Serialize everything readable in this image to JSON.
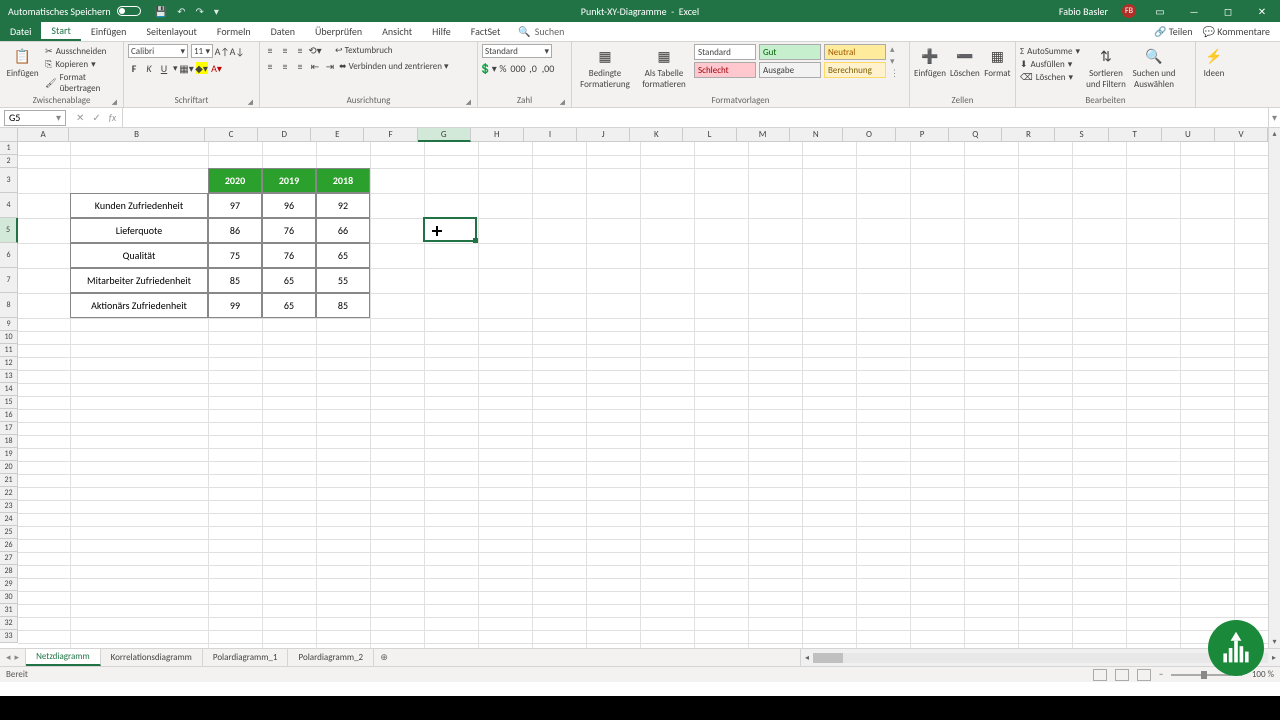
{
  "titlebar": {
    "autosave": "Automatisches Speichern",
    "doc_name": "Punkt-XY-Diagramme",
    "app_name": "Excel",
    "user": "Fabio Basler",
    "initials": "FB"
  },
  "menu": {
    "file": "Datei",
    "tabs": [
      "Start",
      "Einfügen",
      "Seitenlayout",
      "Formeln",
      "Daten",
      "Überprüfen",
      "Ansicht",
      "Hilfe",
      "FactSet"
    ],
    "search": "Suchen",
    "share": "Teilen",
    "comments": "Kommentare"
  },
  "ribbon": {
    "clipboard": {
      "paste": "Einfügen",
      "cut": "Ausschneiden",
      "copy": "Kopieren",
      "format_painter": "Format übertragen",
      "group": "Zwischenablage"
    },
    "font": {
      "name": "Calibri",
      "size": "11",
      "group": "Schriftart"
    },
    "align": {
      "wrap": "Textumbruch",
      "merge": "Verbinden und zentrieren",
      "group": "Ausrichtung"
    },
    "number": {
      "format": "Standard",
      "group": "Zahl"
    },
    "styles": {
      "cond": "Bedingte Formatierung",
      "astable": "Als Tabelle formatieren",
      "standard": "Standard",
      "gut": "Gut",
      "neutral": "Neutral",
      "schlecht": "Schlecht",
      "ausgabe": "Ausgabe",
      "berechnung": "Berechnung",
      "group": "Formatvorlagen"
    },
    "cells": {
      "insert": "Einfügen",
      "delete": "Löschen",
      "format": "Format",
      "group": "Zellen"
    },
    "editing": {
      "autosum": "AutoSumme",
      "fill": "Ausfüllen",
      "clear": "Löschen",
      "sort": "Sortieren und Filtern",
      "find": "Suchen und Auswählen",
      "group": "Bearbeiten"
    },
    "ideas": {
      "label": "Ideen"
    }
  },
  "namebox": "G5",
  "columns": [
    "A",
    "B",
    "C",
    "D",
    "E",
    "F",
    "G",
    "H",
    "I",
    "J",
    "K",
    "L",
    "M",
    "N",
    "O",
    "P",
    "Q",
    "R",
    "S",
    "T",
    "U",
    "V"
  ],
  "chart_data": {
    "type": "table",
    "categories": [
      "2020",
      "2019",
      "2018"
    ],
    "rows": [
      {
        "label": "Kunden Zufriedenheit",
        "values": [
          97,
          96,
          92
        ]
      },
      {
        "label": "Lieferquote",
        "values": [
          86,
          76,
          66
        ]
      },
      {
        "label": "Qualität",
        "values": [
          75,
          76,
          65
        ]
      },
      {
        "label": "Mitarbeiter Zufriedenheit",
        "values": [
          85,
          65,
          55
        ]
      },
      {
        "label": "Aktionärs Zufriedenheit",
        "values": [
          99,
          65,
          85
        ]
      }
    ]
  },
  "sheets": {
    "tabs": [
      "Netzdiagramm",
      "Korrelationsdiagramm",
      "Polardiagramm_1",
      "Polardiagramm_2"
    ],
    "active": 0
  },
  "status": {
    "ready": "Bereit",
    "zoom": "100 %"
  }
}
